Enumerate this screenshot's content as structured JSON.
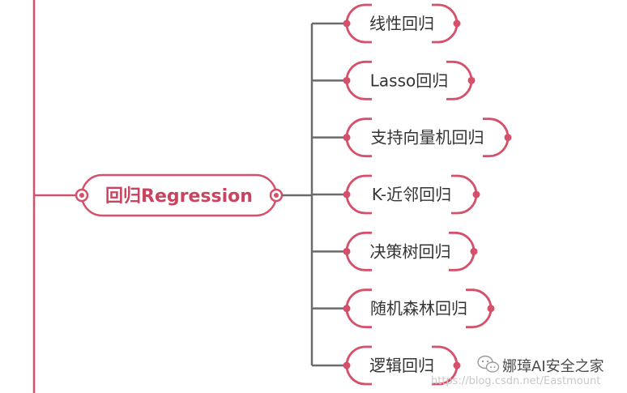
{
  "mindmap": {
    "root": {
      "label": "回归Regression"
    },
    "children": [
      {
        "label": "线性回归"
      },
      {
        "label": "Lasso回归"
      },
      {
        "label": "支持向量机回归"
      },
      {
        "label": "K-近邻回归"
      },
      {
        "label": "决策树回归"
      },
      {
        "label": "随机森林回归"
      },
      {
        "label": "逻辑回归"
      }
    ]
  },
  "watermark": {
    "brand": "娜璋AI安全之家",
    "url": "https://blog.csdn.net/Eastmount",
    "icon": "wechat-icon"
  },
  "colors": {
    "accent": "#d4506b",
    "line": "#6b6b6b",
    "text": "#333333"
  }
}
